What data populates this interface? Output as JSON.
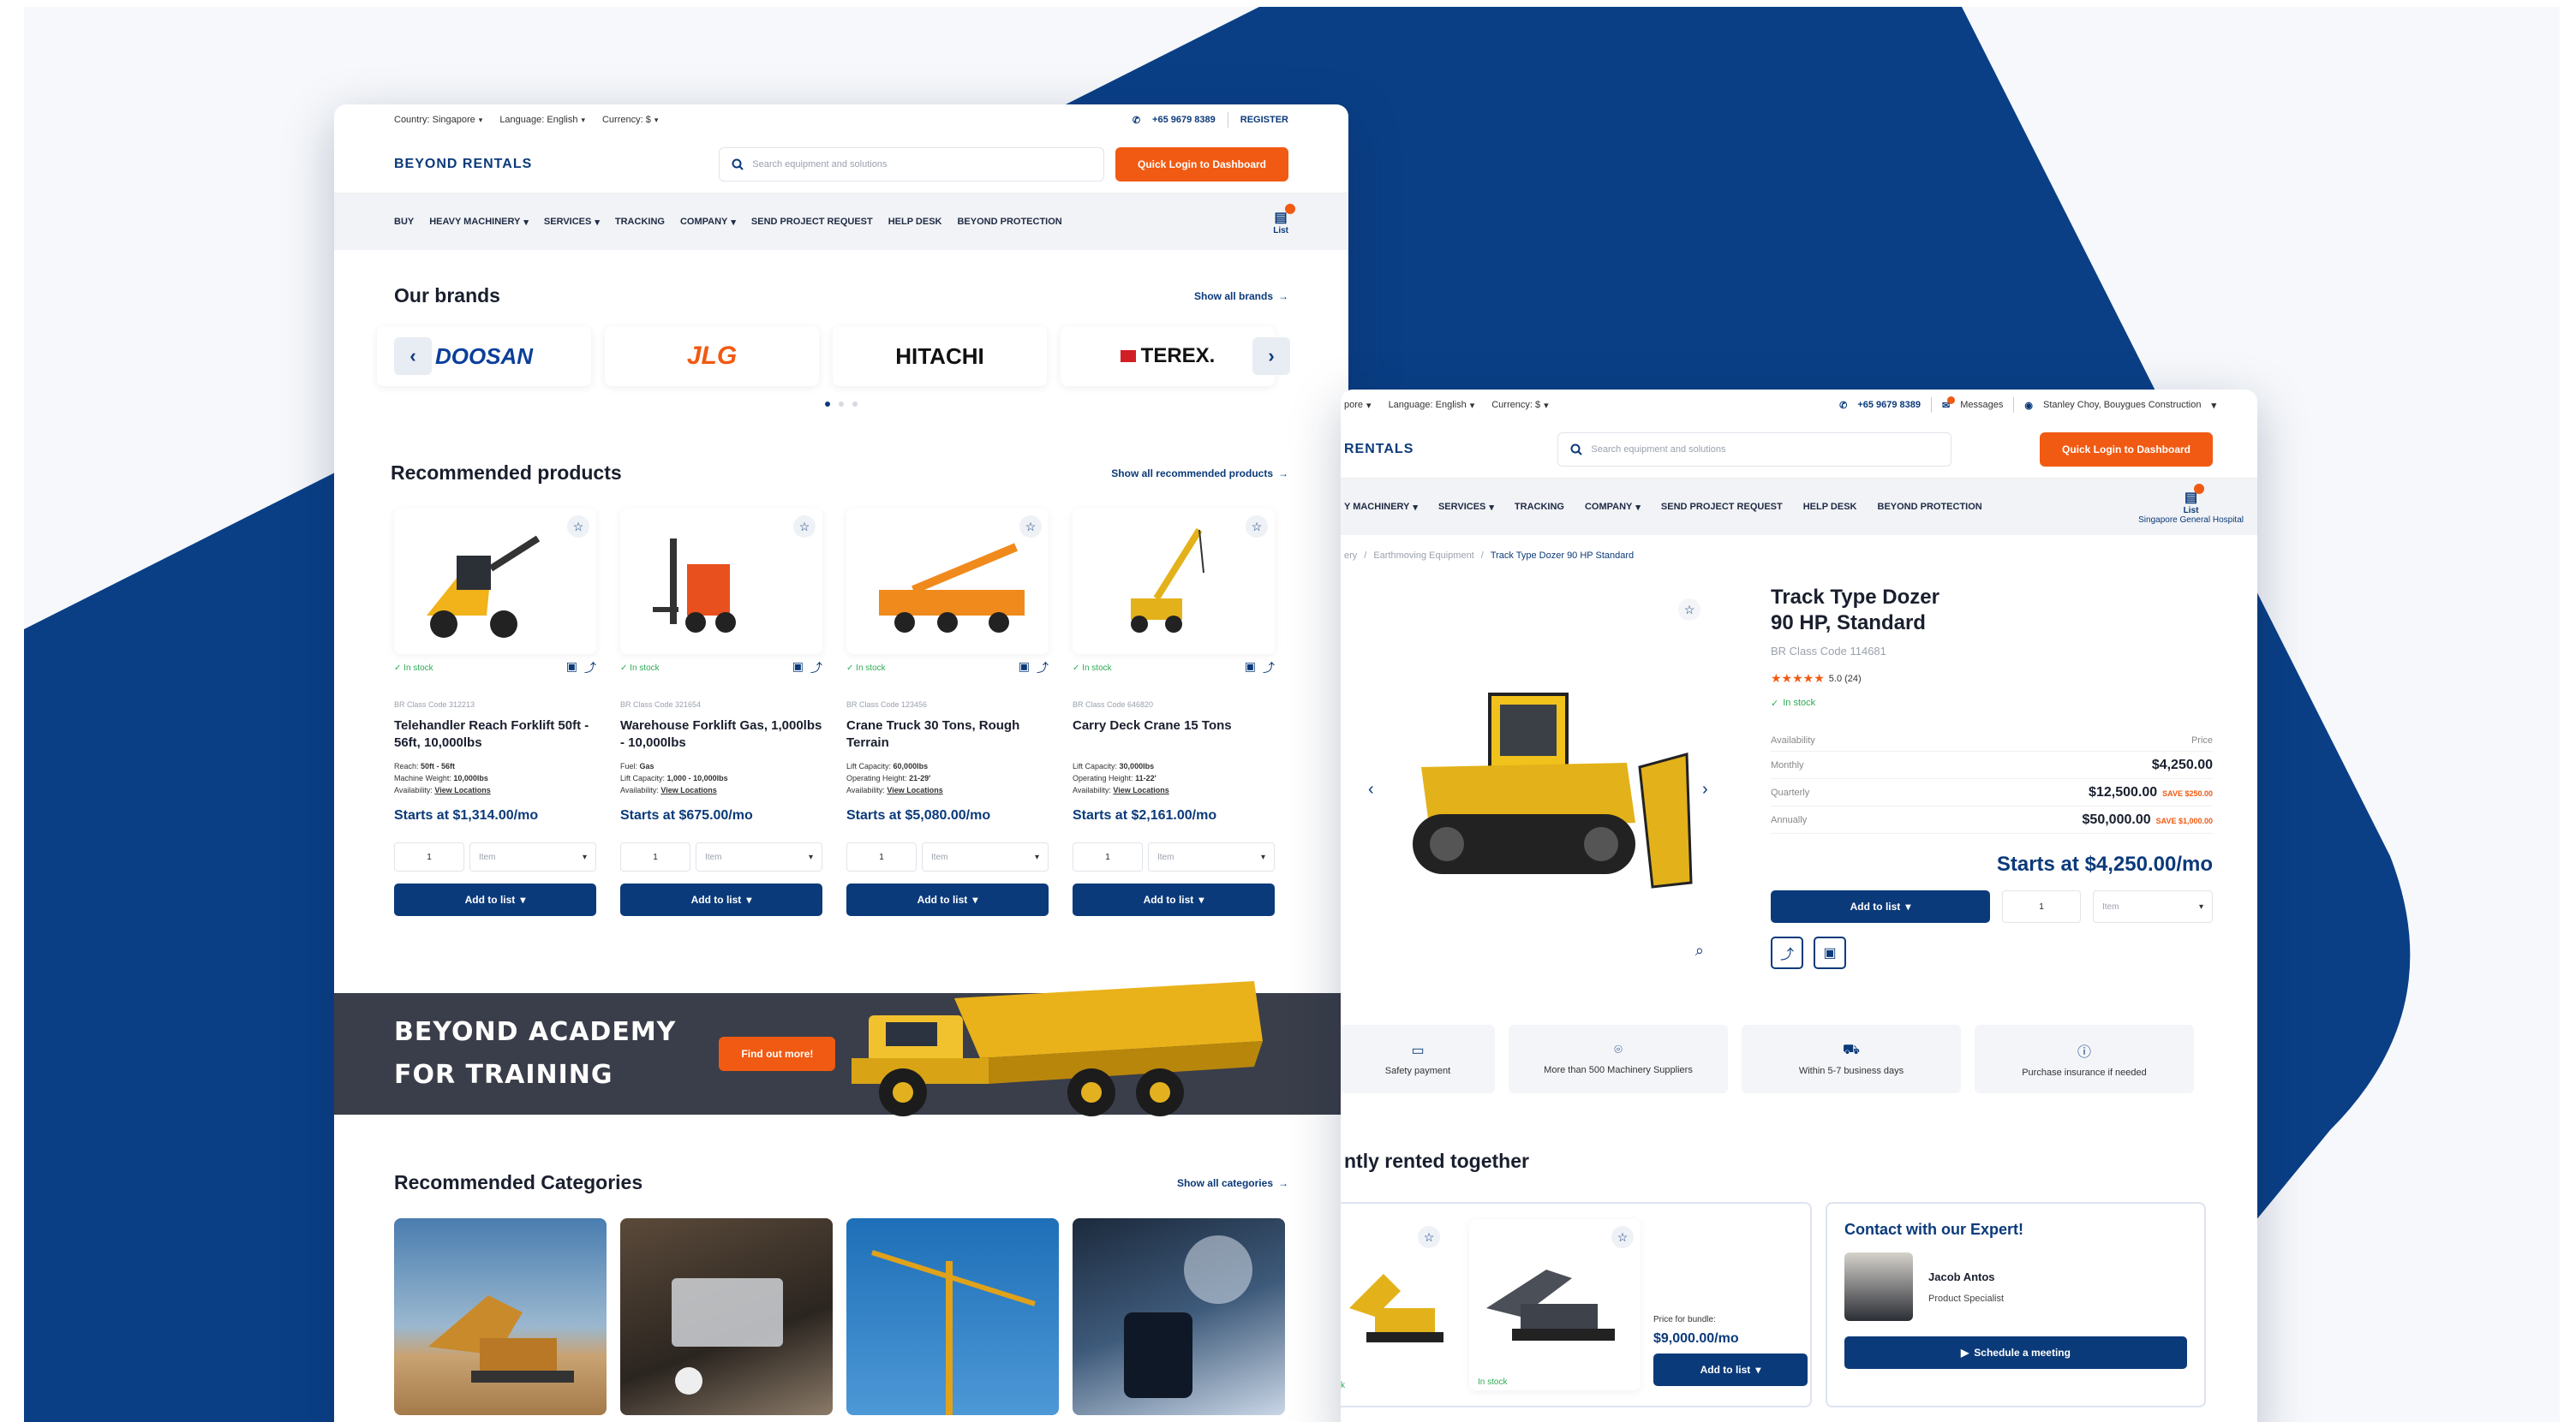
{
  "colors": {
    "navy": "#0b3a7a",
    "orange": "#f15a12",
    "bg_blue": "#0a3f86",
    "in_stock": "#2eaa55"
  },
  "left": {
    "topbar": {
      "country": "Country: Singapore",
      "language": "Language: English",
      "currency": "Currency: $",
      "phone": "+65 9679 8389",
      "register": "REGISTER"
    },
    "header": {
      "logo": "BEYOND RENTALS",
      "search_placeholder": "Search equipment and solutions",
      "cta": "Quick Login to Dashboard"
    },
    "nav": {
      "items": [
        "BUY",
        "HEAVY MACHINERY",
        "SERVICES",
        "TRACKING",
        "COMPANY",
        "SEND PROJECT REQUEST",
        "HELP DESK",
        "BEYOND PROTECTION"
      ],
      "list_label": "List"
    },
    "brands": {
      "title": "Our brands",
      "show_all": "Show all brands",
      "logos": [
        "DOOSAN",
        "JLG",
        "HITACHI",
        "TEREX."
      ]
    },
    "recommended": {
      "title": "Recommended products",
      "show_all": "Show all recommended products",
      "products": [
        {
          "stock": "In stock",
          "code": "BR Class Code 312213",
          "title": "Telehandler Reach Forklift 50ft - 56ft, 10,000lbs",
          "specs": [
            [
              "Reach:",
              "50ft - 56ft"
            ],
            [
              "Machine Weight:",
              "10,000lbs"
            ]
          ],
          "availability": "Availability:",
          "view": "View Locations",
          "price": "Starts at $1,314.00/mo",
          "qty": "1",
          "unit": "Item",
          "add": "Add to list"
        },
        {
          "stock": "In stock",
          "code": "BR Class Code 321654",
          "title": "Warehouse Forklift Gas, 1,000lbs - 10,000lbs",
          "specs": [
            [
              "Fuel:",
              "Gas"
            ],
            [
              "Lift Capacity:",
              "1,000 - 10,000lbs"
            ]
          ],
          "availability": "Availability:",
          "view": "View Locations",
          "price": "Starts at $675.00/mo",
          "qty": "1",
          "unit": "Item",
          "add": "Add to list"
        },
        {
          "stock": "In stock",
          "code": "BR Class Code 123456",
          "title": "Crane Truck 30 Tons, Rough Terrain",
          "specs": [
            [
              "Lift Capacity:",
              "60,000lbs"
            ],
            [
              "Operating Height:",
              "21-29'"
            ]
          ],
          "availability": "Availability:",
          "view": "View Locations",
          "price": "Starts at $5,080.00/mo",
          "qty": "1",
          "unit": "Item",
          "add": "Add to list"
        },
        {
          "stock": "In stock",
          "code": "BR Class Code 646820",
          "title": "Carry Deck Crane 15 Tons",
          "specs": [
            [
              "Lift Capacity:",
              "30,000lbs"
            ],
            [
              "Operating Height:",
              "11-22'"
            ]
          ],
          "availability": "Availability:",
          "view": "View Locations",
          "price": "Starts at $2,161.00/mo",
          "qty": "1",
          "unit": "Item",
          "add": "Add to list"
        }
      ]
    },
    "academy": {
      "line1": "BEYOND ACADEMY",
      "line2": "FOR TRAINING",
      "cta": "Find out more!"
    },
    "categories": {
      "title": "Recommended Categories",
      "show_all": "Show all categories"
    }
  },
  "right": {
    "topbar": {
      "country": "pore",
      "language": "Language: English",
      "currency": "Currency: $",
      "phone": "+65 9679 8389",
      "messages": "Messages",
      "user": "Stanley Choy, Bouygues Construction"
    },
    "header": {
      "logo": "RENTALS",
      "search_placeholder": "Search equipment and solutions",
      "cta": "Quick Login to Dashboard"
    },
    "nav": {
      "items": [
        "Y MACHINERY",
        "SERVICES",
        "TRACKING",
        "COMPANY",
        "SEND PROJECT REQUEST",
        "HELP DESK",
        "BEYOND PROTECTION"
      ],
      "list_label": "List",
      "list_sub": "Singapore General Hospital"
    },
    "breadcrumb": {
      "a": "ery",
      "b": "Earthmoving Equipment",
      "c": "Track Type Dozer 90 HP Standard"
    },
    "product": {
      "title1": "Track Type Dozer",
      "title2": "90 HP, Standard",
      "code": "BR Class Code 114681",
      "rating": "5.0 (24)",
      "stock": "In stock",
      "availability": "Availability",
      "price_head": "Price",
      "rows": [
        {
          "label": "Monthly",
          "value": "$4,250.00",
          "save": ""
        },
        {
          "label": "Quarterly",
          "value": "$12,500.00",
          "save": "SAVE $250.00"
        },
        {
          "label": "Annually",
          "value": "$50,000.00",
          "save": "SAVE $1,000.00"
        }
      ],
      "starts": "Starts at $4,250.00/mo",
      "add": "Add to list",
      "qty": "1",
      "unit": "Item"
    },
    "features": [
      "Safety payment",
      "More than 500 Machinery Suppliers",
      "Within 5-7 business days",
      "Purchase insurance if needed"
    ],
    "together": {
      "title": "ntly rented together",
      "bundle_label": "Price for bundle:",
      "bundle_price": "$9,000.00/mo",
      "add": "Add to list",
      "stock1": "k",
      "stock2": "In stock"
    },
    "expert": {
      "title": "Contact with our Expert!",
      "name": "Jacob Antos",
      "role": "Product Specialist",
      "cta": "Schedule a meeting"
    }
  }
}
